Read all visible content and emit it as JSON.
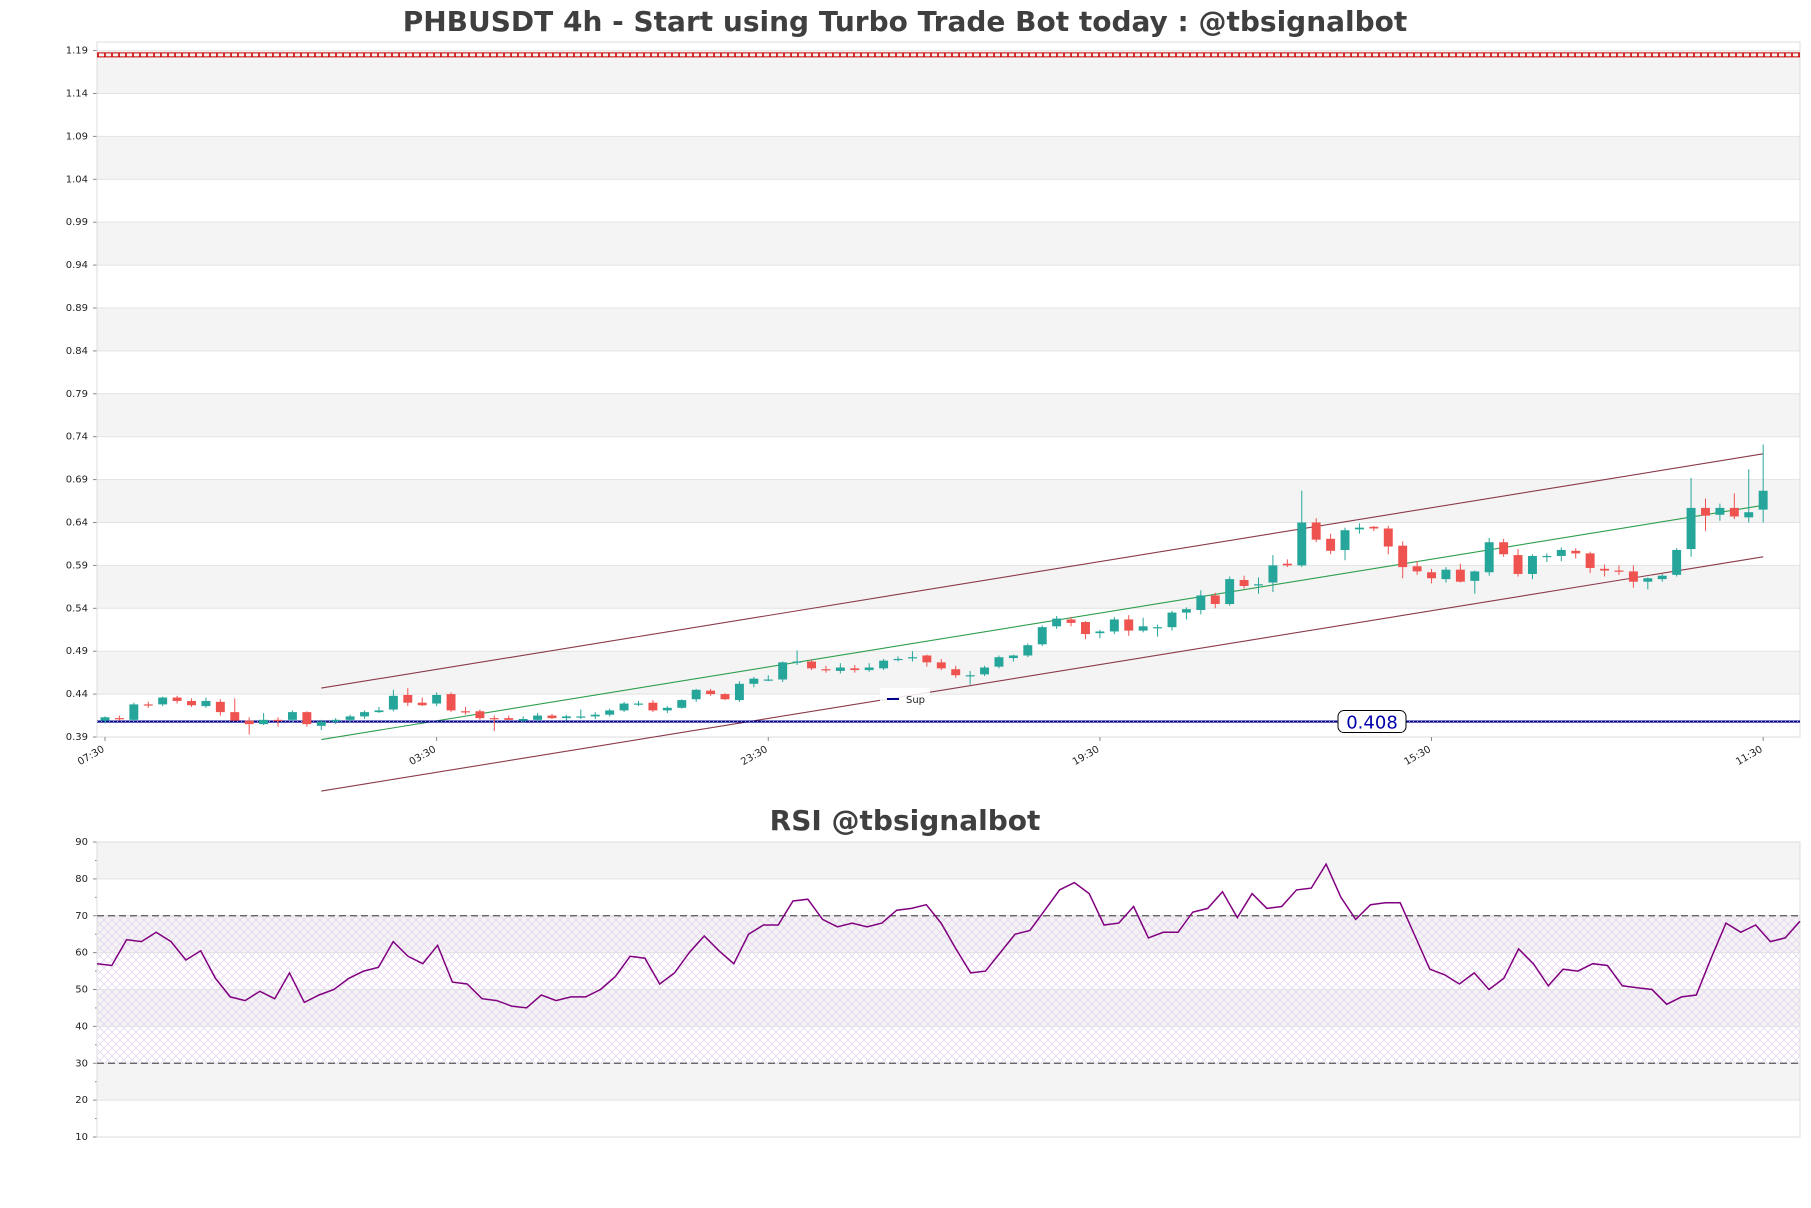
{
  "chart_data": [
    {
      "type": "candlestick",
      "title": "PHBUSDT 4h - Start using Turbo Trade Bot today : @tbsignalbot",
      "ylim": [
        0.39,
        1.2
      ],
      "y_ticks": [
        "0.39",
        "0.44",
        "0.49",
        "0.54",
        "0.59",
        "0.64",
        "0.69",
        "0.74",
        "0.79",
        "0.84",
        "0.89",
        "0.94",
        "0.99",
        "1.04",
        "1.09",
        "1.14",
        "1.19"
      ],
      "x_tick_labels": [
        "07:30",
        "03:30",
        "23:30",
        "19:30",
        "15:30",
        "11:30"
      ],
      "x_tick_index": [
        0,
        23,
        46,
        69,
        92,
        115
      ],
      "bar_count": 118,
      "grid": true,
      "colors": {
        "up": "#26a69a",
        "down": "#ef5350",
        "band": "#f4f4f4",
        "sup": "#00008b",
        "resistance": "#cc0000",
        "channel": "#8b3a4a",
        "midline": "#2e9e4f"
      },
      "candles": [
        [
          0.409,
          0.414,
          0.406,
          0.413
        ],
        [
          0.412,
          0.415,
          0.409,
          0.411
        ],
        [
          0.41,
          0.43,
          0.408,
          0.428
        ],
        [
          0.428,
          0.431,
          0.424,
          0.427
        ],
        [
          0.428,
          0.437,
          0.426,
          0.436
        ],
        [
          0.436,
          0.438,
          0.429,
          0.432
        ],
        [
          0.432,
          0.435,
          0.425,
          0.427
        ],
        [
          0.426,
          0.436,
          0.424,
          0.432
        ],
        [
          0.431,
          0.434,
          0.415,
          0.419
        ],
        [
          0.419,
          0.435,
          0.409,
          0.409
        ],
        [
          0.409,
          0.413,
          0.393,
          0.405
        ],
        [
          0.405,
          0.418,
          0.404,
          0.41
        ],
        [
          0.41,
          0.413,
          0.402,
          0.409
        ],
        [
          0.41,
          0.421,
          0.407,
          0.419
        ],
        [
          0.419,
          0.42,
          0.402,
          0.405
        ],
        [
          0.403,
          0.41,
          0.398,
          0.408
        ],
        [
          0.408,
          0.412,
          0.405,
          0.41
        ],
        [
          0.41,
          0.416,
          0.407,
          0.414
        ],
        [
          0.414,
          0.421,
          0.411,
          0.419
        ],
        [
          0.419,
          0.425,
          0.418,
          0.421
        ],
        [
          0.422,
          0.445,
          0.42,
          0.438
        ],
        [
          0.439,
          0.447,
          0.426,
          0.43
        ],
        [
          0.43,
          0.436,
          0.426,
          0.427
        ],
        [
          0.429,
          0.442,
          0.426,
          0.439
        ],
        [
          0.44,
          0.442,
          0.419,
          0.421
        ],
        [
          0.42,
          0.425,
          0.416,
          0.419
        ],
        [
          0.42,
          0.422,
          0.41,
          0.412
        ],
        [
          0.412,
          0.415,
          0.397,
          0.411
        ],
        [
          0.412,
          0.415,
          0.41,
          0.41
        ],
        [
          0.409,
          0.414,
          0.407,
          0.411
        ],
        [
          0.41,
          0.418,
          0.408,
          0.415
        ],
        [
          0.415,
          0.417,
          0.411,
          0.412
        ],
        [
          0.412,
          0.416,
          0.409,
          0.414
        ],
        [
          0.413,
          0.422,
          0.411,
          0.414
        ],
        [
          0.414,
          0.419,
          0.411,
          0.416
        ],
        [
          0.416,
          0.423,
          0.414,
          0.421
        ],
        [
          0.421,
          0.431,
          0.419,
          0.429
        ],
        [
          0.429,
          0.432,
          0.426,
          0.429
        ],
        [
          0.43,
          0.433,
          0.419,
          0.421
        ],
        [
          0.421,
          0.426,
          0.418,
          0.424
        ],
        [
          0.424,
          0.434,
          0.423,
          0.433
        ],
        [
          0.434,
          0.446,
          0.431,
          0.445
        ],
        [
          0.444,
          0.446,
          0.438,
          0.44
        ],
        [
          0.44,
          0.441,
          0.433,
          0.434
        ],
        [
          0.433,
          0.455,
          0.431,
          0.452
        ],
        [
          0.452,
          0.46,
          0.448,
          0.458
        ],
        [
          0.457,
          0.462,
          0.455,
          0.457
        ],
        [
          0.457,
          0.478,
          0.454,
          0.477
        ],
        [
          0.477,
          0.491,
          0.474,
          0.478
        ],
        [
          0.478,
          0.48,
          0.468,
          0.47
        ],
        [
          0.469,
          0.473,
          0.465,
          0.468
        ],
        [
          0.467,
          0.476,
          0.464,
          0.471
        ],
        [
          0.47,
          0.474,
          0.465,
          0.468
        ],
        [
          0.468,
          0.476,
          0.466,
          0.471
        ],
        [
          0.47,
          0.481,
          0.468,
          0.479
        ],
        [
          0.48,
          0.484,
          0.478,
          0.481
        ],
        [
          0.482,
          0.49,
          0.478,
          0.483
        ],
        [
          0.485,
          0.486,
          0.472,
          0.477
        ],
        [
          0.477,
          0.481,
          0.468,
          0.47
        ],
        [
          0.469,
          0.473,
          0.459,
          0.462
        ],
        [
          0.462,
          0.467,
          0.451,
          0.462
        ],
        [
          0.463,
          0.473,
          0.461,
          0.471
        ],
        [
          0.472,
          0.485,
          0.47,
          0.483
        ],
        [
          0.482,
          0.486,
          0.478,
          0.485
        ],
        [
          0.485,
          0.499,
          0.483,
          0.497
        ],
        [
          0.498,
          0.52,
          0.496,
          0.518
        ],
        [
          0.519,
          0.531,
          0.516,
          0.528
        ],
        [
          0.527,
          0.53,
          0.519,
          0.523
        ],
        [
          0.524,
          0.525,
          0.504,
          0.51
        ],
        [
          0.511,
          0.515,
          0.505,
          0.513
        ],
        [
          0.513,
          0.53,
          0.51,
          0.527
        ],
        [
          0.527,
          0.532,
          0.508,
          0.514
        ],
        [
          0.514,
          0.529,
          0.512,
          0.519
        ],
        [
          0.518,
          0.521,
          0.507,
          0.518
        ],
        [
          0.518,
          0.537,
          0.514,
          0.535
        ],
        [
          0.535,
          0.541,
          0.527,
          0.539
        ],
        [
          0.538,
          0.561,
          0.533,
          0.555
        ],
        [
          0.555,
          0.558,
          0.54,
          0.545
        ],
        [
          0.545,
          0.577,
          0.543,
          0.574
        ],
        [
          0.573,
          0.578,
          0.563,
          0.566
        ],
        [
          0.567,
          0.576,
          0.557,
          0.568
        ],
        [
          0.57,
          0.602,
          0.559,
          0.59
        ],
        [
          0.592,
          0.597,
          0.588,
          0.59
        ],
        [
          0.59,
          0.677,
          0.588,
          0.64
        ],
        [
          0.64,
          0.645,
          0.617,
          0.62
        ],
        [
          0.621,
          0.627,
          0.603,
          0.607
        ],
        [
          0.608,
          0.634,
          0.596,
          0.631
        ],
        [
          0.632,
          0.639,
          0.627,
          0.634
        ],
        [
          0.635,
          0.636,
          0.63,
          0.633
        ],
        [
          0.633,
          0.636,
          0.603,
          0.612
        ],
        [
          0.613,
          0.618,
          0.575,
          0.588
        ],
        [
          0.589,
          0.595,
          0.579,
          0.583
        ],
        [
          0.582,
          0.586,
          0.569,
          0.575
        ],
        [
          0.574,
          0.588,
          0.57,
          0.585
        ],
        [
          0.585,
          0.592,
          0.57,
          0.571
        ],
        [
          0.572,
          0.584,
          0.557,
          0.583
        ],
        [
          0.582,
          0.622,
          0.578,
          0.617
        ],
        [
          0.617,
          0.621,
          0.6,
          0.603
        ],
        [
          0.602,
          0.609,
          0.577,
          0.58
        ],
        [
          0.58,
          0.603,
          0.574,
          0.601
        ],
        [
          0.6,
          0.604,
          0.594,
          0.601
        ],
        [
          0.601,
          0.611,
          0.595,
          0.608
        ],
        [
          0.607,
          0.61,
          0.598,
          0.604
        ],
        [
          0.604,
          0.606,
          0.581,
          0.587
        ],
        [
          0.586,
          0.591,
          0.577,
          0.584
        ],
        [
          0.584,
          0.59,
          0.579,
          0.583
        ],
        [
          0.583,
          0.59,
          0.564,
          0.571
        ],
        [
          0.571,
          0.576,
          0.562,
          0.575
        ],
        [
          0.574,
          0.58,
          0.571,
          0.578
        ],
        [
          0.579,
          0.61,
          0.577,
          0.608
        ],
        [
          0.609,
          0.692,
          0.6,
          0.657
        ],
        [
          0.657,
          0.668,
          0.63,
          0.648
        ],
        [
          0.649,
          0.662,
          0.642,
          0.657
        ],
        [
          0.657,
          0.674,
          0.644,
          0.647
        ],
        [
          0.646,
          0.702,
          0.64,
          0.652
        ],
        [
          0.655,
          0.731,
          0.64,
          0.677
        ]
      ],
      "sup_line": {
        "label": "Sup",
        "value": 0.408,
        "value_label": "0.408"
      },
      "resistance_line": {
        "value": 1.185
      },
      "channel": {
        "upper": {
          "start_index": 15,
          "start_value": 0.447,
          "end_index": 115,
          "end_value": 0.72
        },
        "middle": {
          "start_index": 15,
          "start_value": 0.387,
          "end_index": 115,
          "end_value": 0.66
        },
        "lower": {
          "start_index": 15,
          "start_value": 0.327,
          "end_index": 115,
          "end_value": 0.6
        }
      }
    },
    {
      "type": "line",
      "title": "RSI @tbsignalbot",
      "ylim": [
        10,
        90
      ],
      "y_ticks": [
        "10",
        "20",
        "30",
        "40",
        "50",
        "60",
        "70",
        "80",
        "90"
      ],
      "overbought": 70,
      "oversold": 30,
      "grid": true,
      "colors": {
        "line": "#800080",
        "band": "#f4f4f4",
        "hatch": "#d6b3e6",
        "threshold": "#555555"
      },
      "series": [
        {
          "values": [
            57,
            56.5,
            63.5,
            63,
            65.5,
            63,
            58,
            60.5,
            53,
            48,
            47,
            49.5,
            47.5,
            54.5,
            46.5,
            48.5,
            50,
            53,
            55,
            56,
            63,
            59,
            57,
            62,
            52,
            51.5,
            47.5,
            47,
            45.5,
            45,
            48.5,
            47,
            48,
            48,
            50,
            53.5,
            59,
            58.5,
            51.5,
            54.5,
            60,
            64.5,
            60.5,
            57,
            65,
            67.5,
            67.5,
            74,
            74.5,
            69,
            67,
            68,
            67,
            68,
            71.5,
            72,
            73,
            68,
            61,
            54.5,
            55,
            60,
            65,
            66,
            71.5,
            77,
            79,
            76,
            67.5,
            68,
            72.5,
            64,
            65.5,
            65.5,
            71,
            72,
            76.5,
            69.5,
            76,
            72,
            72.5,
            77,
            77.5,
            84,
            75,
            69,
            73,
            73.5,
            73.5,
            64.5,
            55.5,
            54,
            51.5,
            54.5,
            50,
            53,
            61,
            57,
            51,
            55.5,
            55,
            57,
            56.5,
            51,
            50.5,
            50,
            46,
            48,
            48.5,
            58.5,
            68,
            65.5,
            67.5,
            63,
            64,
            68.5
          ]
        }
      ]
    }
  ]
}
